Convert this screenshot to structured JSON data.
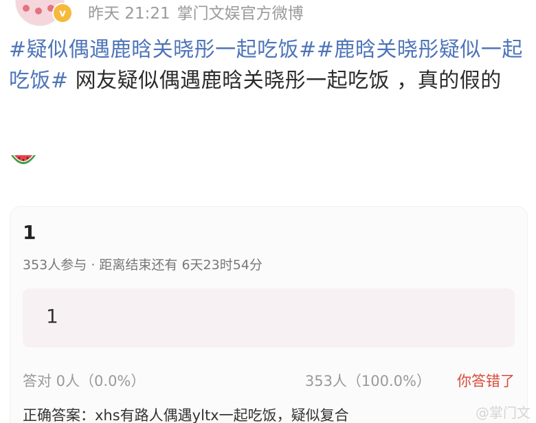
{
  "header": {
    "time_text": "昨天 21:21",
    "source_text": "掌门文娱官方微博",
    "verified_glyph": "v"
  },
  "post": {
    "hashtag1": "#疑似偶遇鹿晗关晓彤一起吃饭#",
    "hashtag2": "#鹿晗关晓彤疑似一起吃饭#",
    "body": " 网友疑似偶遇鹿晗关晓彤一起吃饭 ，真的假的",
    "emoji": "watermelon-icon"
  },
  "poll": {
    "title": "1",
    "participants": "353人参与",
    "separator": "·",
    "countdown": "距离结束还有 6天23时54分",
    "option_label": "1",
    "correct_count": "答对  0人（0.0%）",
    "option_count": "353人（100.0%）",
    "result": "你答错了",
    "answer": "正确答案：xhs有路人偶遇yltx一起吃饭，疑似复合"
  },
  "watermark": "@掌门文",
  "colors": {
    "hashtag": "#4d74b8",
    "error": "#d94a3a",
    "verified": "#f6b93b"
  }
}
